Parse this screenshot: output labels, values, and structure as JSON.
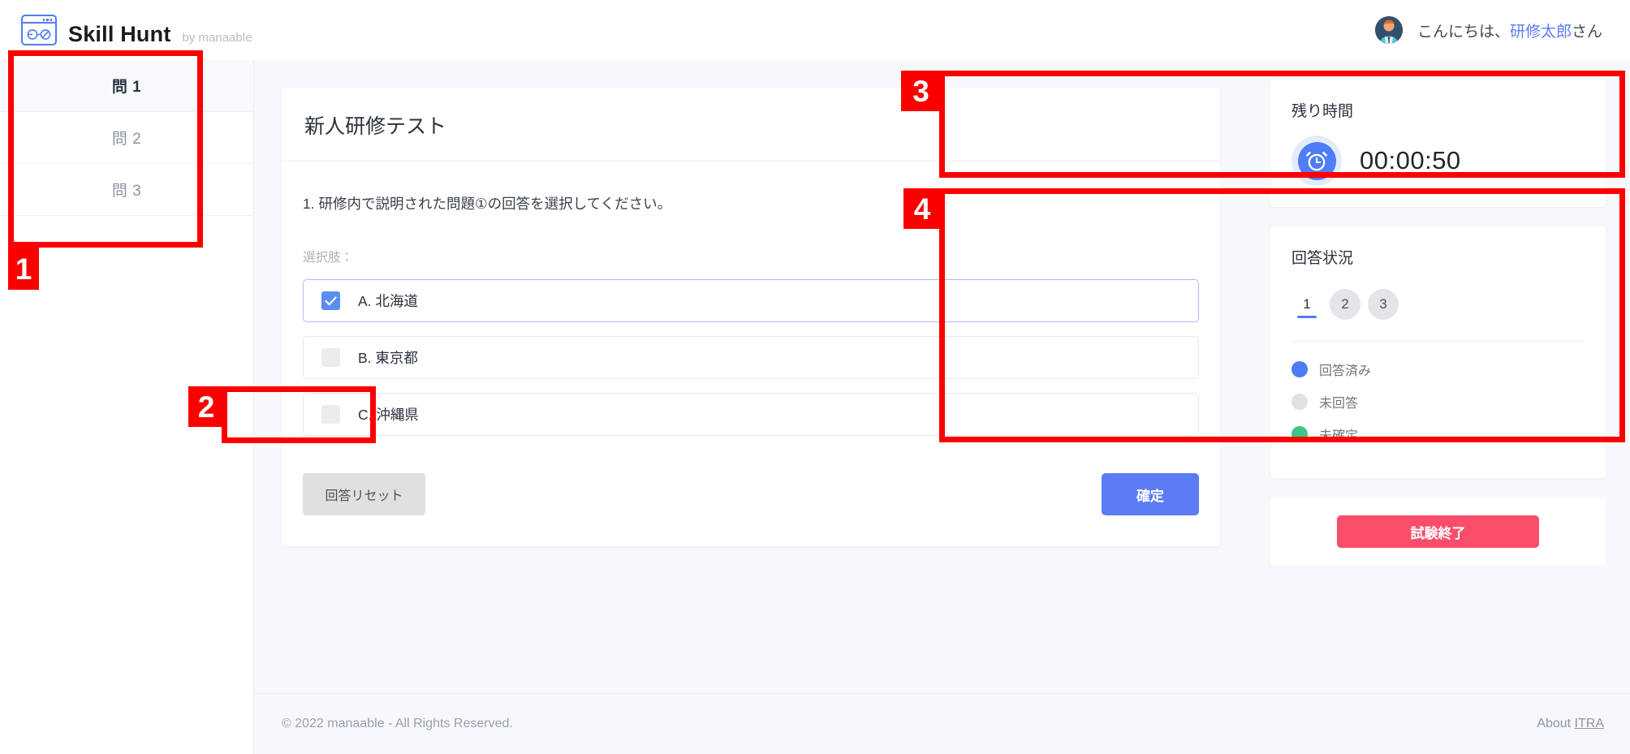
{
  "header": {
    "brand_name": "Skill Hunt",
    "brand_sub": "by manaable",
    "logo_icon": "glasses-browser-logo",
    "avatar_icon": "user-avatar",
    "greeting_prefix": "こんにちは、",
    "user_name": "研修太郎",
    "greeting_suffix": "さん"
  },
  "sidebar": {
    "items": [
      {
        "label": "問 1",
        "active": true
      },
      {
        "label": "問 2",
        "active": false
      },
      {
        "label": "問 3",
        "active": false
      }
    ]
  },
  "main": {
    "card_title": "新人研修テスト",
    "question_text": "1. 研修内で説明された問題①の回答を選択してください。",
    "choices_label": "選択肢：",
    "choices": [
      {
        "label": "A. 北海道",
        "checked": true
      },
      {
        "label": "B. 東京都",
        "checked": false
      },
      {
        "label": "C. 沖縄県",
        "checked": false
      }
    ],
    "reset_label": "回答リセット",
    "confirm_label": "確定"
  },
  "timer_panel": {
    "title": "残り時間",
    "icon": "alarm-clock-icon",
    "value": "00:00:50"
  },
  "status_panel": {
    "title": "回答状況",
    "pages": [
      {
        "label": "1",
        "state": "current"
      },
      {
        "label": "2",
        "state": "unanswered"
      },
      {
        "label": "3",
        "state": "unanswered"
      }
    ],
    "legend": [
      {
        "label": "回答済み",
        "color": "#4d7cf3"
      },
      {
        "label": "未回答",
        "color": "#e0e1e4"
      },
      {
        "label": "未確定",
        "color": "#3ec682"
      }
    ]
  },
  "finish": {
    "label": "試験終了"
  },
  "footer": {
    "copyright": "© 2022 manaable - All Rights Reserved.",
    "about_prefix": "About ",
    "about_link": "ITRA"
  },
  "annotations": [
    {
      "number": "1"
    },
    {
      "number": "2"
    },
    {
      "number": "3"
    },
    {
      "number": "4"
    }
  ],
  "colors": {
    "accent_blue": "#5b7cf5",
    "danger_red": "#fa4d6a",
    "annotation_red": "#fc0000",
    "green": "#3ec682"
  }
}
